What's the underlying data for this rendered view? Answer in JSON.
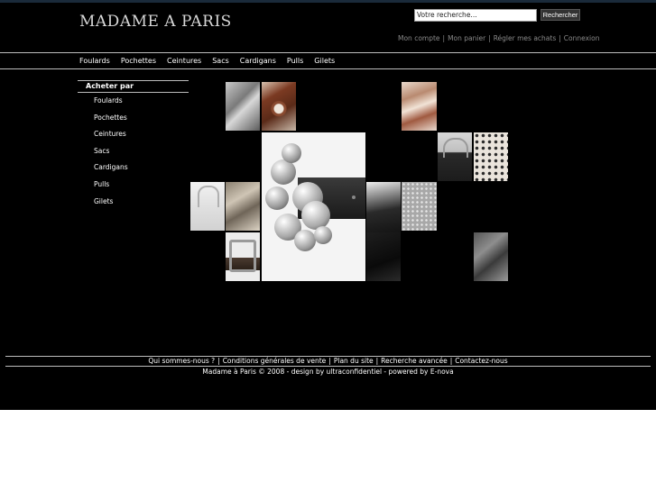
{
  "header": {
    "logo": "MADAME A PARIS",
    "search": {
      "value": "Votre recherche...",
      "button": "Rechercher"
    },
    "account_links": [
      "Mon compte",
      "Mon panier",
      "Régler mes achats",
      "Connexion"
    ]
  },
  "nav": [
    "Foulards",
    "Pochettes",
    "Ceintures",
    "Sacs",
    "Cardigans",
    "Pulls",
    "Gilets"
  ],
  "sidebar": {
    "title": "Acheter par",
    "items": [
      "Foulards",
      "Pochettes",
      "Ceintures",
      "Sacs",
      "Cardigans",
      "Pulls",
      "Gilets"
    ]
  },
  "gallery": {
    "tiles": [
      {
        "name": "grey-knit-tile"
      },
      {
        "name": "leather-eyelet-belt-tile"
      },
      {
        "name": "silk-scarf-tile"
      },
      {
        "name": "chain-bag-tile"
      },
      {
        "name": "patterned-scarf-tile"
      },
      {
        "name": "silver-ball-belt-tile"
      },
      {
        "name": "white-chain-bag-tile"
      },
      {
        "name": "studded-pochette-tile"
      },
      {
        "name": "black-leather-tile"
      },
      {
        "name": "grey-studded-bag-tile"
      },
      {
        "name": "buckle-belt-tile"
      },
      {
        "name": "black-stitched-tile"
      },
      {
        "name": "grey-cardigan-tile"
      }
    ]
  },
  "footer": {
    "links": [
      "Qui sommes-nous ?",
      "Conditions générales de vente",
      "Plan du site",
      "Recherche avancée",
      "Contactez-nous"
    ],
    "copyright": "Madame à Paris © 2008 - design by ultraconfidentiel - powered by E-nova"
  }
}
